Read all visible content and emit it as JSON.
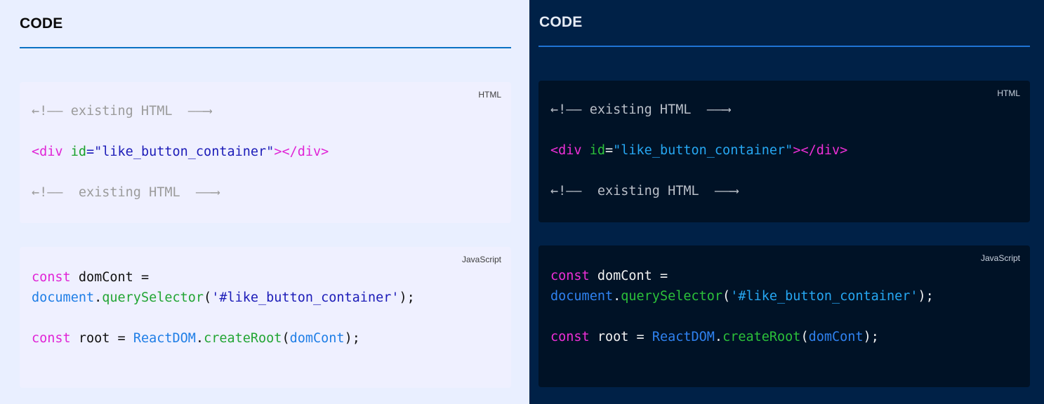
{
  "light": {
    "heading": "CODE",
    "html_card": {
      "lang": "HTML",
      "comment1": "←!—— existing HTML  ——⟶",
      "tag_open": "<div ",
      "attr_name": "id",
      "eq": "=",
      "attr_value": "\"like_button_container\"",
      "tag_close": "></div>",
      "comment2": "←!——  existing HTML  ——⟶"
    },
    "js_card": {
      "lang": "JavaScript",
      "l1_kw": "const",
      "l1_rest": " domCont =",
      "l2_obj": "document",
      "l2_dot": ".",
      "l2_fn": "querySelector",
      "l2_open": "(",
      "l2_str": "'#like_button_container'",
      "l2_close": ");",
      "l3_kw": "const",
      "l3_mid": " root = ",
      "l3_obj": "ReactDOM",
      "l3_dot": ".",
      "l3_fn": "createRoot",
      "l3_open": "(",
      "l3_arg": "domCont",
      "l3_close": ");"
    }
  },
  "dark": {
    "heading": "CODE",
    "html_card": {
      "lang": "HTML",
      "comment1": "←!—— existing HTML  ——⟶",
      "tag_open": "<div ",
      "attr_name": "id",
      "eq": "=",
      "attr_value": "\"like_button_container\"",
      "tag_close": "></div>",
      "comment2": "←!——  existing HTML  ——⟶"
    },
    "js_card": {
      "lang": "JavaScript",
      "l1_kw": "const",
      "l1_rest": " domCont =",
      "l2_obj": "document",
      "l2_dot": ".",
      "l2_fn": "querySelector",
      "l2_open": "(",
      "l2_str": "'#like_button_container'",
      "l2_close": ");",
      "l3_kw": "const",
      "l3_mid": " root = ",
      "l3_obj": "ReactDOM",
      "l3_dot": ".",
      "l3_fn": "createRoot",
      "l3_open": "(",
      "l3_arg": "domCont",
      "l3_close": ");"
    }
  }
}
